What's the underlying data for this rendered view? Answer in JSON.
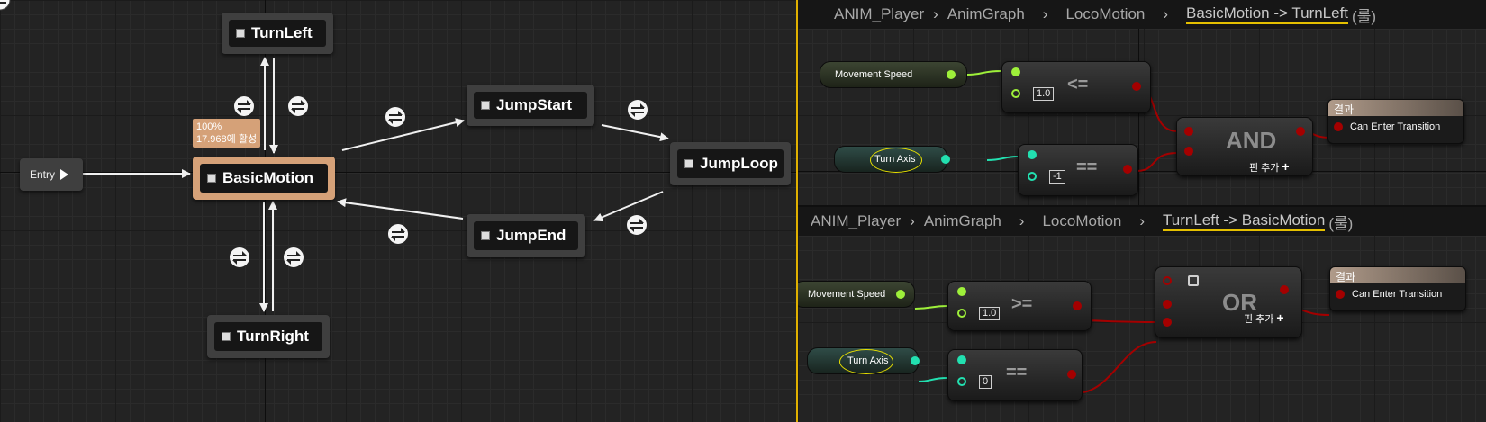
{
  "state_machine": {
    "entry_label": "Entry",
    "states": {
      "turn_left": "TurnLeft",
      "basic_motion": "BasicMotion",
      "turn_right": "TurnRight",
      "jump_start": "JumpStart",
      "jump_loop": "JumpLoop",
      "jump_end": "JumpEnd"
    },
    "active_tooltip": {
      "percent": "100%",
      "active_for": "17.968에 활성"
    },
    "colors": {
      "active_state": "#d5a178",
      "state": "#3f3f3f"
    }
  },
  "transition_top": {
    "breadcrumb": [
      "ANIM_Player",
      "AnimGraph",
      "LocoMotion",
      "BasicMotion -> TurnLeft"
    ],
    "breadcrumb_note": "(룰)",
    "movement_speed": "Movement Speed",
    "turn_axis": "Turn Axis",
    "compare1": {
      "literal": "1.0",
      "op": "<="
    },
    "compare2": {
      "literal": "-1",
      "op": "=="
    },
    "logic": {
      "op": "AND",
      "add_pin": "핀 추가"
    },
    "result": {
      "header": "결과",
      "label": "Can Enter Transition"
    }
  },
  "transition_bottom": {
    "breadcrumb": [
      "ANIM_Player",
      "AnimGraph",
      "LocoMotion",
      "TurnLeft -> BasicMotion"
    ],
    "breadcrumb_note": "(룰)",
    "movement_speed": "Movement Speed",
    "turn_axis": "Turn Axis",
    "compare1": {
      "literal": "1.0",
      "op": ">="
    },
    "compare2": {
      "literal": "0",
      "op": "=="
    },
    "logic": {
      "op": "OR",
      "add_pin": "핀 추가"
    },
    "result": {
      "header": "결과",
      "label": "Can Enter Transition"
    }
  },
  "icons": {
    "transition": "transition-rule-icon",
    "add_pin": "plus-icon",
    "state": "state-square-icon"
  },
  "colors": {
    "float_pin": "#9ef03a",
    "turn_axis_pin": "#22e0b0",
    "bool_pin": "#a40000",
    "highlight": "#e5c000"
  }
}
